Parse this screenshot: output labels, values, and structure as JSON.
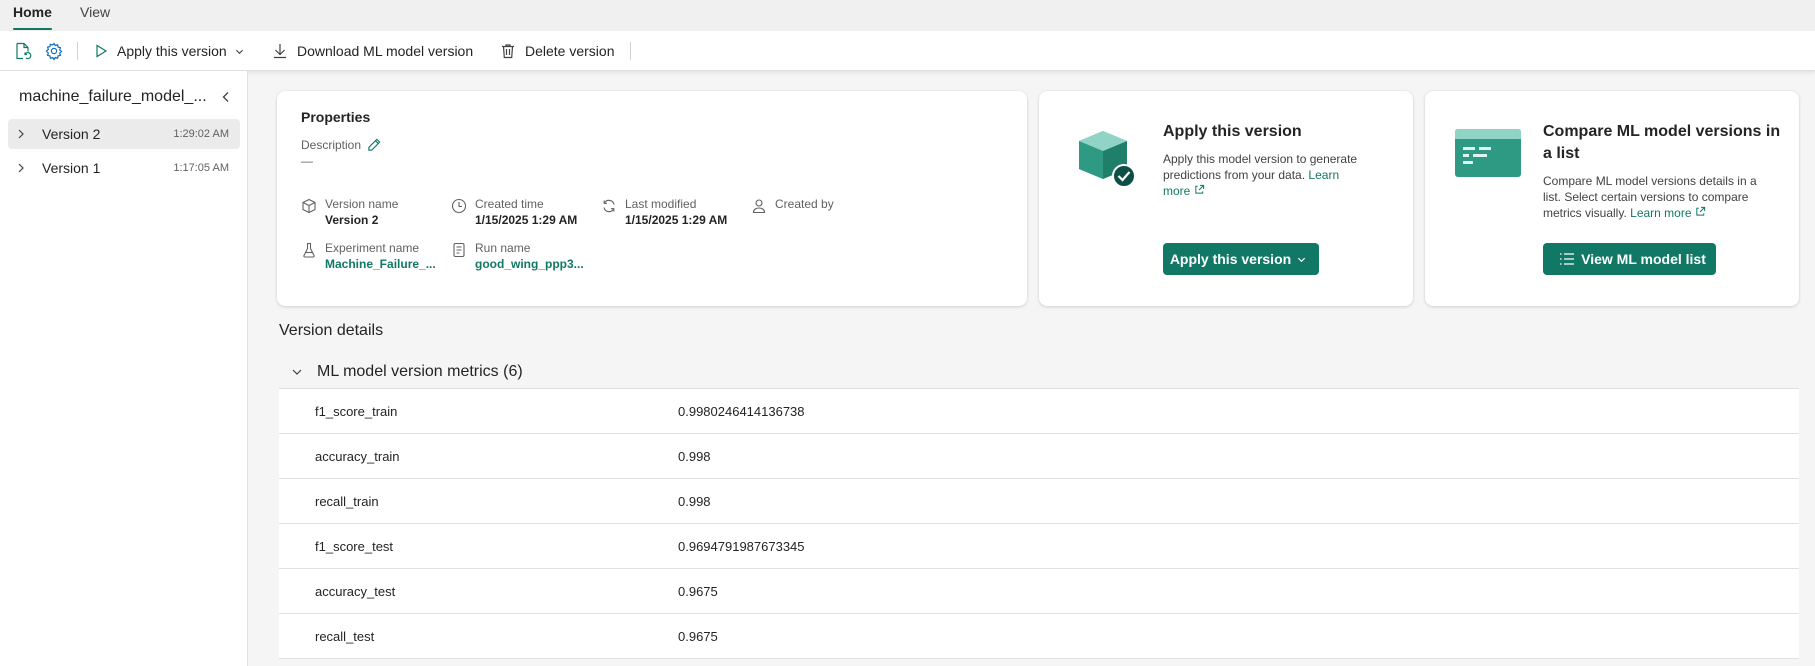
{
  "ribbon": {
    "tabs": [
      {
        "label": "Home",
        "active": true
      },
      {
        "label": "View",
        "active": false
      }
    ]
  },
  "toolbar": {
    "apply_label": "Apply this version",
    "download_label": "Download ML model version",
    "delete_label": "Delete version"
  },
  "sidebar": {
    "model_name": "machine_failure_model_...",
    "versions": [
      {
        "label": "Version 2",
        "time": "1:29:02 AM",
        "selected": true
      },
      {
        "label": "Version 1",
        "time": "1:17:05 AM",
        "selected": false
      }
    ]
  },
  "properties": {
    "title": "Properties",
    "description_label": "Description",
    "description_value": "—",
    "version_name": {
      "label": "Version name",
      "value": "Version 2"
    },
    "created_time": {
      "label": "Created time",
      "value": "1/15/2025 1:29 AM"
    },
    "last_modified": {
      "label": "Last modified",
      "value": "1/15/2025 1:29 AM"
    },
    "created_by": {
      "label": "Created by",
      "value": ""
    },
    "experiment_name": {
      "label": "Experiment name",
      "value": "Machine_Failure_..."
    },
    "run_name": {
      "label": "Run name",
      "value": "good_wing_ppp3..."
    }
  },
  "apply_card": {
    "title": "Apply this version",
    "desc": "Apply this model version to generate predictions from your data.",
    "learn_more": "Learn more",
    "button": "Apply this version"
  },
  "compare_card": {
    "title": "Compare ML model versions in a list",
    "desc": "Compare ML model versions details in a list. Select certain versions to compare metrics visually.",
    "learn_more": "Learn more",
    "button": "View ML model list"
  },
  "details": {
    "title": "Version details",
    "metrics_header": "ML model version metrics (6)",
    "metrics": [
      {
        "name": "f1_score_train",
        "value": "0.9980246414136738"
      },
      {
        "name": "accuracy_train",
        "value": "0.998"
      },
      {
        "name": "recall_train",
        "value": "0.998"
      },
      {
        "name": "f1_score_test",
        "value": "0.9694791987673345"
      },
      {
        "name": "accuracy_test",
        "value": "0.9675"
      },
      {
        "name": "recall_test",
        "value": "0.9675"
      }
    ]
  },
  "colors": {
    "accent": "#117865",
    "icon_blue": "#0f6cbd"
  },
  "icons": {
    "toolbar": [
      "refresh-document-icon",
      "settings-icon",
      "play-icon",
      "download-icon",
      "trash-icon"
    ],
    "properties": [
      "cube-icon",
      "clock-icon",
      "sync-icon",
      "person-icon",
      "flask-icon",
      "document-icon"
    ]
  }
}
